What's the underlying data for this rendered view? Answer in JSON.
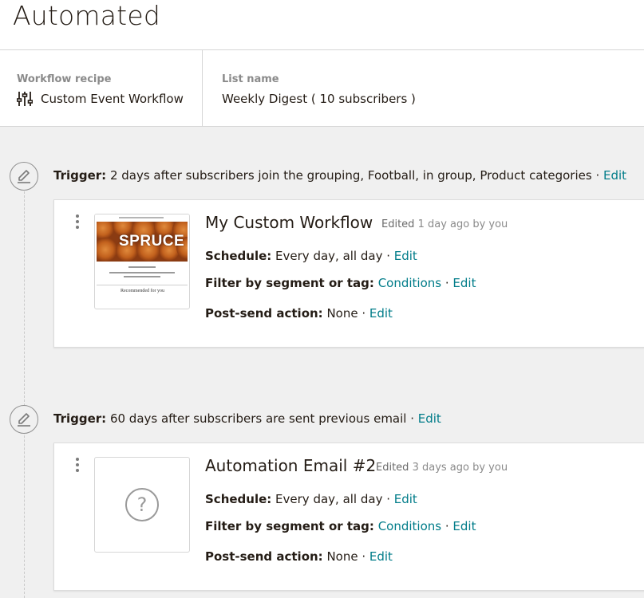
{
  "page": {
    "title": "Automated"
  },
  "meta": {
    "recipe_label": "Workflow recipe",
    "recipe_value": "Custom Event Workflow",
    "recipe_icon": "sliders-icon",
    "list_label": "List name",
    "list_value": "Weekly Digest ( 10 subscribers )"
  },
  "steps": [
    {
      "trigger_label": "Trigger:",
      "trigger_text": " 2 days after subscribers join the grouping, Football, in group, Product categories · ",
      "trigger_edit": "Edit",
      "email": {
        "title": "My Custom Workflow",
        "edited_prefix": "Edited",
        "edited_rest": " 1 day ago by you",
        "thumbnail": "spruce-email-preview",
        "thumb_word": "SPRUCE",
        "thumb_footer": "Recommended for you",
        "schedule_label": "Schedule:",
        "schedule_value": " Every day, all day · ",
        "schedule_edit": "Edit",
        "filter_label": "Filter by segment or tag:",
        "filter_link": "Conditions",
        "filter_sep": " · ",
        "filter_edit": "Edit",
        "postsend_label": "Post-send action:",
        "postsend_value": " None · ",
        "postsend_edit": "Edit"
      }
    },
    {
      "trigger_label": "Trigger:",
      "trigger_text": " 60 days after subscribers are sent previous email · ",
      "trigger_edit": "Edit",
      "email": {
        "title": "Automation Email #2",
        "edited_prefix": "Edited",
        "edited_rest": " 3 days ago by you",
        "thumbnail": "question-icon",
        "thumb_glyph": "?",
        "schedule_label": "Schedule:",
        "schedule_value": " Every day, all day · ",
        "schedule_edit": "Edit",
        "filter_label": "Filter by segment or tag:",
        "filter_link": "Conditions",
        "filter_sep": " · ",
        "filter_edit": "Edit",
        "postsend_label": "Post-send action:",
        "postsend_value": " None · ",
        "postsend_edit": "Edit"
      }
    }
  ],
  "colors": {
    "link": "#007c89",
    "background": "#f0f0f0",
    "text": "#241c15"
  }
}
